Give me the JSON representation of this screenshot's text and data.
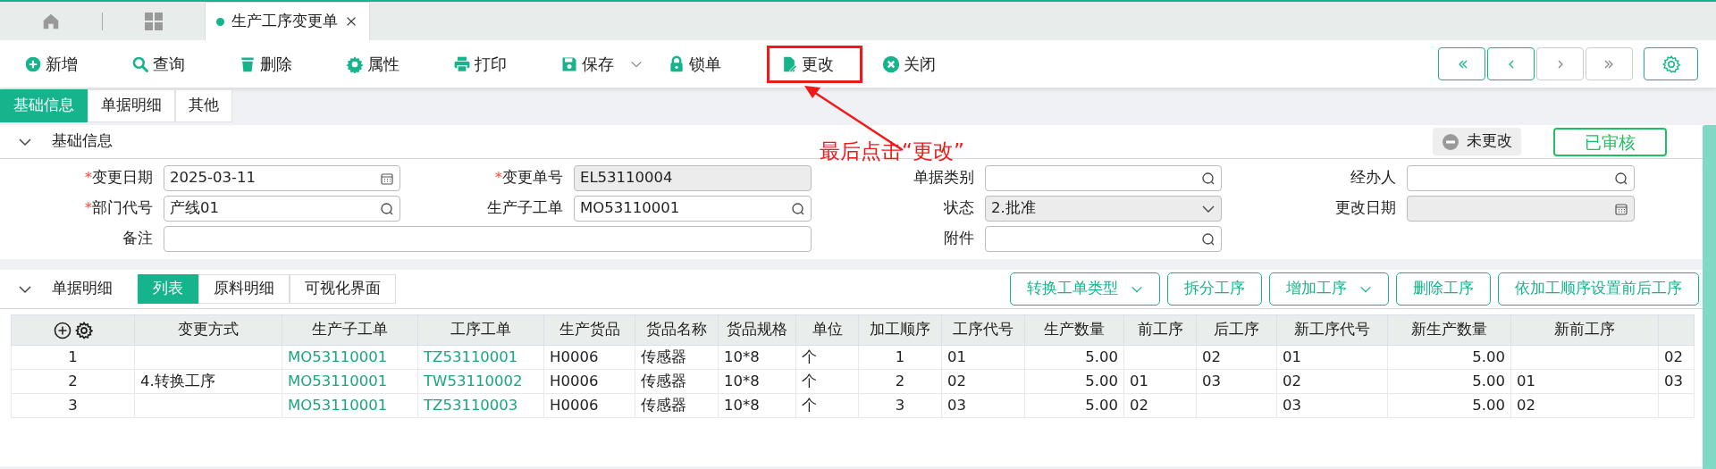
{
  "tabs": [
    {
      "label": "生产工序变更单",
      "selected": true
    }
  ],
  "toolbar": [
    {
      "kind": "add",
      "label": "新增",
      "dropdown": false,
      "highlighted": false
    },
    {
      "kind": "search",
      "label": "查询",
      "dropdown": false,
      "highlighted": false
    },
    {
      "kind": "delete",
      "label": "删除",
      "dropdown": false,
      "highlighted": false
    },
    {
      "kind": "properties",
      "label": "属性",
      "dropdown": false,
      "highlighted": false
    },
    {
      "kind": "print",
      "label": "打印",
      "dropdown": false,
      "highlighted": false
    },
    {
      "kind": "save",
      "label": "保存",
      "dropdown": true,
      "highlighted": false
    },
    {
      "kind": "lock",
      "label": "锁单",
      "dropdown": false,
      "highlighted": false
    },
    {
      "kind": "edit",
      "label": "更改",
      "dropdown": false,
      "highlighted": true
    },
    {
      "kind": "close",
      "label": "关闭",
      "dropdown": false,
      "highlighted": false
    }
  ],
  "nav_buttons": [
    {
      "kind": "first",
      "disabled": false
    },
    {
      "kind": "prev",
      "disabled": false
    },
    {
      "kind": "next",
      "disabled": true
    },
    {
      "kind": "last",
      "disabled": true
    }
  ],
  "annotation": {
    "text": "最后点击“更改”"
  },
  "form_tabs": [
    {
      "label": "基础信息",
      "selected": true
    },
    {
      "label": "单据明细",
      "selected": false
    },
    {
      "label": "其他",
      "selected": false
    }
  ],
  "basic_section": {
    "title": "基础信息",
    "expanded": true,
    "change_status": "未更改",
    "audit_status": "已审核",
    "fields": [
      {
        "label": "变更日期",
        "required_mark": "*",
        "kind": "date",
        "value": "2025-03-11",
        "disabled": false
      },
      {
        "label": "变更单号",
        "required_mark": "*",
        "kind": "text",
        "value": "EL53110004",
        "disabled": true
      },
      {
        "label": "单据类别",
        "kind": "lookup",
        "disabled": false
      },
      {
        "label": "经办人",
        "kind": "lookup",
        "disabled": false
      },
      {
        "label": "部门代号",
        "required_mark": "*",
        "kind": "lookup",
        "value": "产线01",
        "disabled": false
      },
      {
        "label": "生产子工单",
        "kind": "lookup",
        "value": "MO53110001",
        "disabled": false
      },
      {
        "label": "状态",
        "kind": "select",
        "value": "2.批准",
        "disabled": true
      },
      {
        "label": "更改日期",
        "kind": "date",
        "disabled": true
      },
      {
        "label": "备注",
        "kind": "memo",
        "disabled": false
      },
      {
        "label": "附件",
        "kind": "lookup",
        "disabled": false
      }
    ]
  },
  "detail_section": {
    "title": "单据明细",
    "expanded": true,
    "view_tabs": [
      {
        "label": "列表",
        "selected": true
      },
      {
        "label": "原料明细",
        "selected": false
      },
      {
        "label": "可视化界面",
        "selected": false
      }
    ],
    "actions": [
      {
        "label": "转换工单类型",
        "dropdown": true
      },
      {
        "label": "拆分工序",
        "dropdown": false
      },
      {
        "label": "增加工序",
        "dropdown": true
      },
      {
        "label": "删除工序",
        "dropdown": false
      },
      {
        "label": "依加工顺序设置前后工序",
        "dropdown": false
      }
    ],
    "table": {
      "columns": [
        "变更方式",
        "生产子工单",
        "工序工单",
        "生产货品",
        "货品名称",
        "货品规格",
        "单位",
        "加工顺序",
        "工序代号",
        "生产数量",
        "前工序",
        "后工序",
        "新工序代号",
        "新生产数量",
        "新前工序"
      ],
      "rows": [
        {
          "number": "1",
          "cells": [
            null,
            "MO53110001",
            "TZ53110001",
            "H0006",
            "传感器",
            "10*8",
            "个",
            "1",
            "01",
            "5.00",
            null,
            "02",
            "01",
            "5.00",
            null,
            "02"
          ]
        },
        {
          "number": "2",
          "cells": [
            "4.转换工序",
            "MO53110001",
            "TW53110002",
            "H0006",
            "传感器",
            "10*8",
            "个",
            "2",
            "02",
            "5.00",
            "01",
            "03",
            "02",
            "5.00",
            "01",
            "03"
          ]
        },
        {
          "number": "3",
          "cells": [
            null,
            "MO53110001",
            "TZ53110003",
            "H0006",
            "传感器",
            "10*8",
            "个",
            "3",
            "03",
            "5.00",
            "02",
            null,
            "03",
            "5.00",
            "02",
            null
          ]
        }
      ]
    }
  }
}
